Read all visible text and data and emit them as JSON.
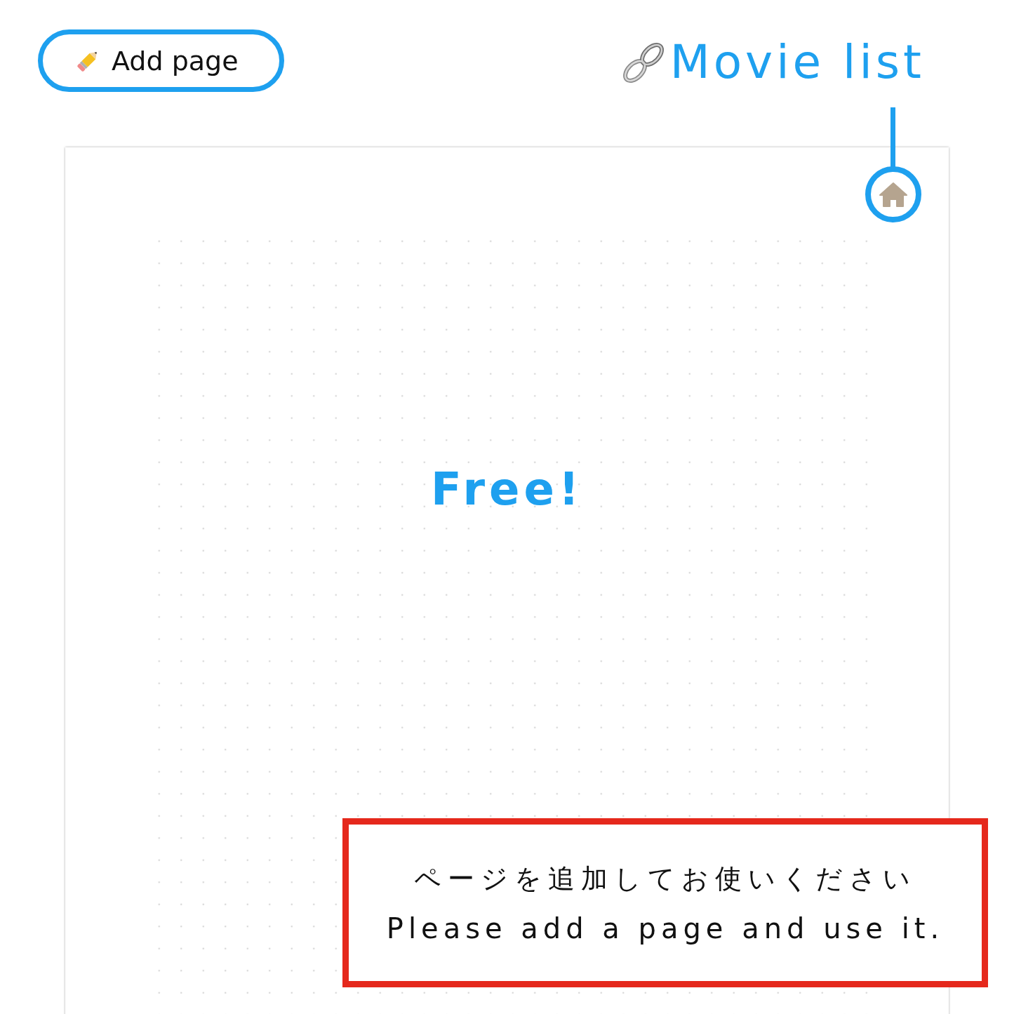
{
  "add_page_button": {
    "label": "Add page"
  },
  "movie_list_link": {
    "label": "Movie list"
  },
  "page": {
    "title": "Free!"
  },
  "notice": {
    "lines": [
      "ページを追加してお使いください",
      "Please add a page and use it."
    ]
  }
}
